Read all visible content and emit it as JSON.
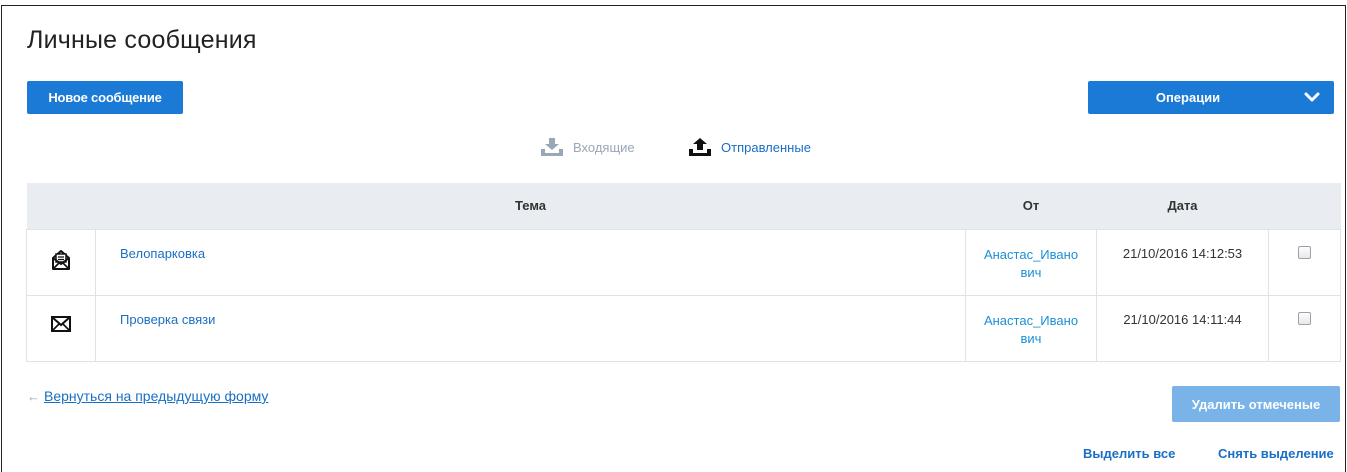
{
  "page": {
    "title": "Личные сообщения"
  },
  "toolbar": {
    "new_message_label": "Новое сообщение",
    "operations_label": "Операции"
  },
  "folders": {
    "inbox_label": "Входящие",
    "sent_label": "Отправленные"
  },
  "table": {
    "columns": {
      "subject": "Тема",
      "from": "От",
      "date": "Дата"
    },
    "rows": [
      {
        "icon": "envelope-open-icon",
        "subject": "Велопарковка",
        "from": "Анастас_Ивано\nвич",
        "date": "21/10/2016 14:12:53",
        "checked": false
      },
      {
        "icon": "envelope-icon",
        "subject": "Проверка связи",
        "from": "Анастас_Ивано\nвич",
        "date": "21/10/2016 14:11:44",
        "checked": false
      }
    ]
  },
  "footer": {
    "back_arrow": "←",
    "back_link": "Вернуться на предыдущую форму",
    "delete_label": "Удалить отмеченые",
    "select_all": "Выделить все",
    "deselect_all": "Снять выделение"
  },
  "colors": {
    "primary": "#1a7ad6",
    "link": "#1a6fc4",
    "disabled_button": "#7ab3e8",
    "header_bg": "#e9edf1"
  }
}
